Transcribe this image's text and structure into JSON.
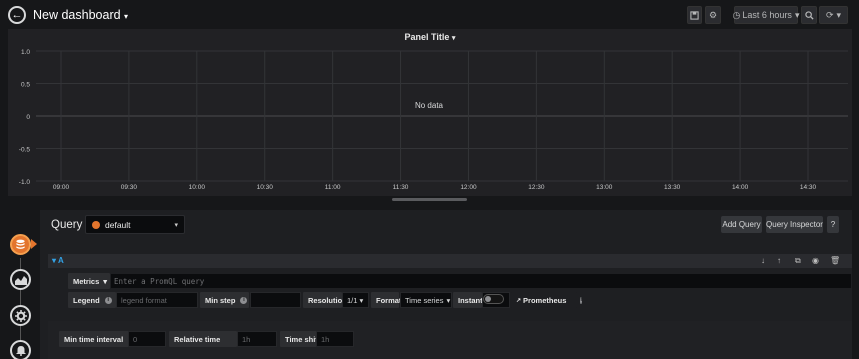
{
  "navbar": {
    "title": "New dashboard",
    "time_range": "Last 6 hours",
    "icons": [
      "back-arrow-icon",
      "save-icon",
      "gear-icon",
      "clock-icon",
      "zoom-icon",
      "refresh-icon"
    ]
  },
  "panel": {
    "title": "Panel Title",
    "no_data": "No data"
  },
  "chart_data": {
    "type": "line",
    "title": "Panel Title",
    "x_ticks": [
      "09:00",
      "09:30",
      "10:00",
      "10:30",
      "11:00",
      "11:30",
      "12:00",
      "12:30",
      "13:00",
      "13:30",
      "14:00",
      "14:30"
    ],
    "y_ticks": [
      "1.0",
      "0.5",
      "0",
      "-0.5",
      "-1.0"
    ],
    "ylim": [
      -1.0,
      1.0
    ],
    "series": [],
    "grid": true,
    "annotation": "No data"
  },
  "editor": {
    "query_label": "Query",
    "datasource": "default",
    "add_query": "Add Query",
    "query_inspector": "Query Inspector",
    "help": "?",
    "query_a": {
      "ref": "A",
      "metrics_label": "Metrics",
      "metrics_placeholder": "Enter a PromQL query",
      "legend_label": "Legend",
      "legend_placeholder": "legend format",
      "min_step_label": "Min step",
      "resolution_label": "Resolution",
      "resolution_value": "1/1",
      "format_label": "Format",
      "format_value": "Time series",
      "instant_label": "Instant",
      "prometheus_link": "Prometheus"
    },
    "options": {
      "min_interval_label": "Min time interval",
      "min_interval_placeholder": "0",
      "relative_time_label": "Relative time",
      "relative_time_placeholder": "1h",
      "time_shift_label": "Time shift",
      "time_shift_placeholder": "1h"
    }
  },
  "sidebar": {
    "icons": [
      "database-icon",
      "visualization-icon",
      "settings-icon",
      "alert-bell-icon"
    ]
  }
}
